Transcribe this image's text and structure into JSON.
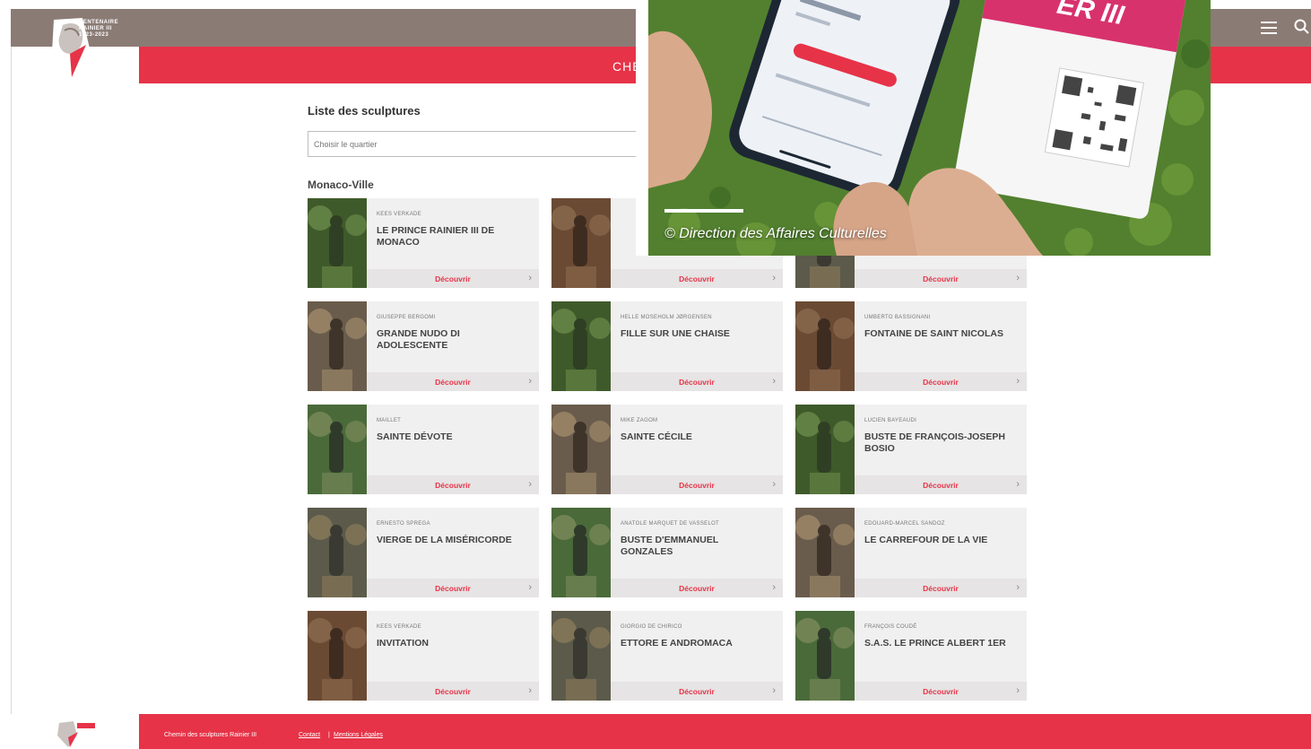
{
  "header": {
    "logo_text": "CENTENAIRE RAINIER III 1923-2023",
    "nav_partial": "CHE"
  },
  "main": {
    "title": "Liste des sculptures",
    "district_select": {
      "placeholder": "Choisir le quartier"
    },
    "section_title": "Monaco-Ville",
    "discover_label": "Découvrir",
    "cards": [
      {
        "artist": "Kees Verkade",
        "name": "Le Prince Rainier III de Monaco"
      },
      {
        "artist": "",
        "name": ""
      },
      {
        "artist": "",
        "name": ""
      },
      {
        "artist": "Giuseppe Bergomi",
        "name": "Grande nudo di adolescente"
      },
      {
        "artist": "Helle Moseholm Jørgensen",
        "name": "Fille sur une chaise"
      },
      {
        "artist": "Umberto Bassignani",
        "name": "Fontaine de Saint Nicolas"
      },
      {
        "artist": "Maillet",
        "name": "Sainte Dévote"
      },
      {
        "artist": "Mike Zagom",
        "name": "Sainte Cécile"
      },
      {
        "artist": "Lucien Bayeaudi",
        "name": "Buste de François-Joseph Bosio"
      },
      {
        "artist": "Ernesto Sprega",
        "name": "Vierge de la Miséricorde"
      },
      {
        "artist": "Anatole Marquet de Vasselot",
        "name": "Buste d'Emmanuel Gonzales"
      },
      {
        "artist": "Edouard-Marcel Sandoz",
        "name": "Le Carrefour de la vie"
      },
      {
        "artist": "Kees Verkade",
        "name": "Invitation"
      },
      {
        "artist": "Giorgio de Chirico",
        "name": "Ettore e Andromaca"
      },
      {
        "artist": "François Coudé",
        "name": "S.A.S. le Prince Albert 1er"
      }
    ]
  },
  "footer": {
    "brand": "Chemin des sculptures Rainier III",
    "links": [
      "Contact",
      "Mentions Légales"
    ]
  },
  "photo": {
    "credit": "© Direction des Affaires Culturelles",
    "card_text": "ER III"
  },
  "colors": {
    "brand_red": "#e63348",
    "top_bar": "#8b7b75",
    "card_bg": "#f1f0f0"
  }
}
